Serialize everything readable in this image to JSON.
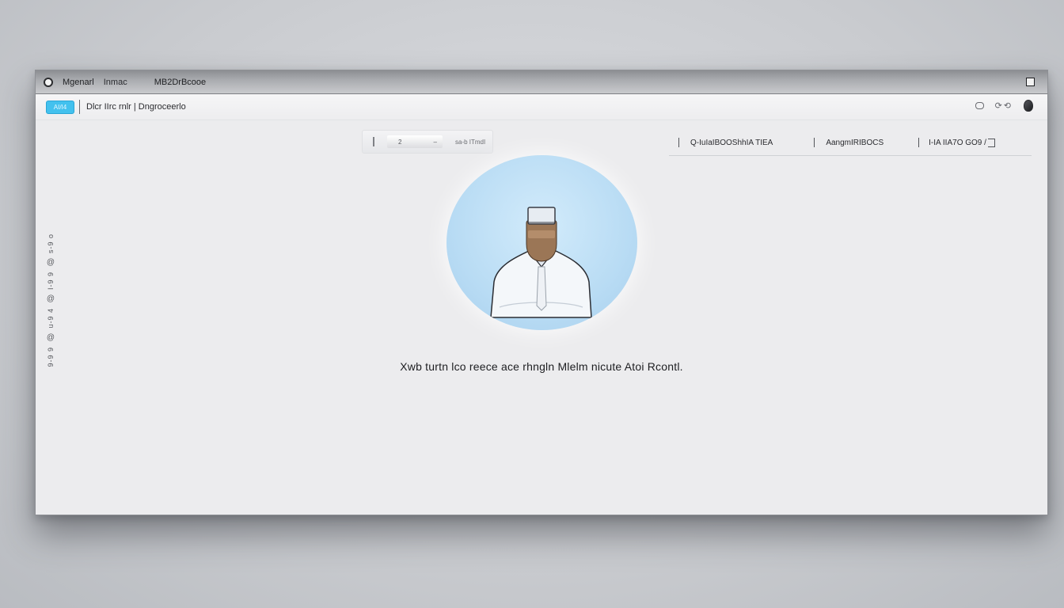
{
  "titlebar": {
    "app_name": "Mgenarl",
    "app_sub": "Inmac",
    "document": "MB2DrBcooe"
  },
  "toolbar": {
    "badge": "AI/I4",
    "breadcrumb": "Dlcr IIrc rnlr | Dngroceerlo"
  },
  "segment": {
    "value": "2",
    "label": "sa-b ITmdI"
  },
  "tabs": [
    {
      "label": "Q-IuIaIBOOShhIA TIEA"
    },
    {
      "label": "AangmIRIBOCS"
    },
    {
      "label": "I-IA IIA7O GO9 /"
    }
  ],
  "sidebar": {
    "items": [
      "s-9 o",
      "I-9 9",
      "u-9 4",
      "9-9 9"
    ]
  },
  "main": {
    "message": "Xwb turtn lco reece ace rhngln Mlelm nicute Atoi Rcontl."
  },
  "colors": {
    "accent": "#43c1ee",
    "avatar_bg": "#b9dcf4"
  }
}
